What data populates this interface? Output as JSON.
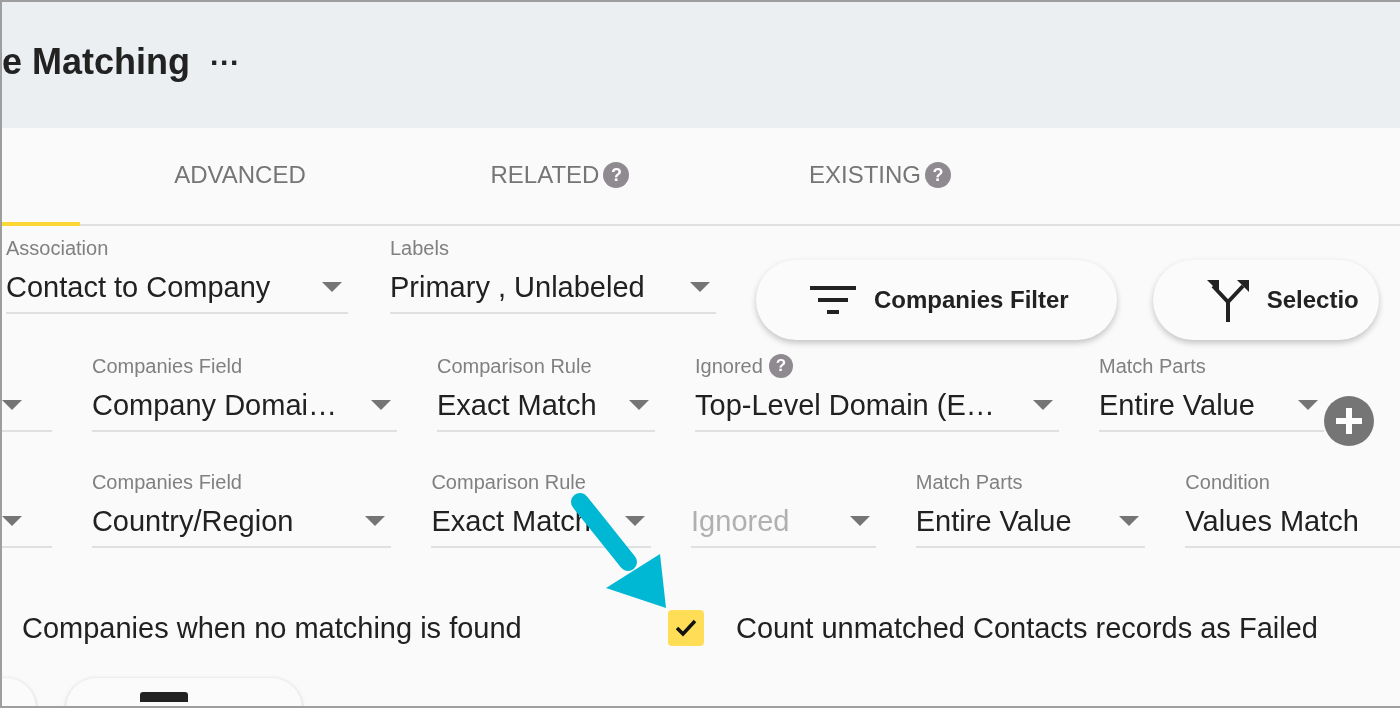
{
  "header": {
    "title": "e Matching",
    "menu": "···"
  },
  "tabs": [
    {
      "selected": true
    },
    {
      "label": "ADVANCED",
      "selected": false
    },
    {
      "label": "RELATED",
      "selected": false,
      "help": "?"
    },
    {
      "label": "EXISTING",
      "selected": false,
      "help": "?"
    }
  ],
  "association_row": {
    "fields": [
      {
        "label": "Association",
        "value": "Contact to Company",
        "dropdown": true
      },
      {
        "label": "Labels",
        "value": "Primary , Unlabeled",
        "dropdown": true
      }
    ],
    "buttons": [
      {
        "kind": "filter",
        "label": "Companies Filter"
      },
      {
        "kind": "split",
        "label": "Selectio"
      }
    ]
  },
  "rules": [
    {
      "fields": [
        {
          "dropdown": true
        },
        {
          "label": "Companies Field",
          "value": "Company Domai…",
          "dropdown": true
        },
        {
          "label": "Comparison Rule",
          "value": "Exact Match",
          "dropdown": true
        },
        {
          "label": "Ignored",
          "help": "?",
          "value": "Top-Level Domain (E…",
          "dropdown": true
        },
        {
          "label": "Match Parts",
          "value": "Entire Value",
          "dropdown": true
        }
      ],
      "add_button": true
    },
    {
      "fields": [
        {
          "dropdown": true
        },
        {
          "label": "Companies Field",
          "value": "Country/Region",
          "dropdown": true
        },
        {
          "label": "Comparison Rule",
          "value": "Exact Match",
          "dropdown": true
        },
        {
          "placeholder": "Ignored",
          "disabled": true,
          "dropdown": true
        },
        {
          "label": "Match Parts",
          "value": "Entire Value",
          "dropdown": true
        },
        {
          "label": "Condition",
          "value": "Values Match",
          "dropdown": false
        }
      ],
      "add_button": false
    }
  ],
  "options": [
    {
      "label": "Companies when no matching is found"
    },
    {
      "label": "Count unmatched Contacts records as Failed",
      "checked": true
    }
  ]
}
